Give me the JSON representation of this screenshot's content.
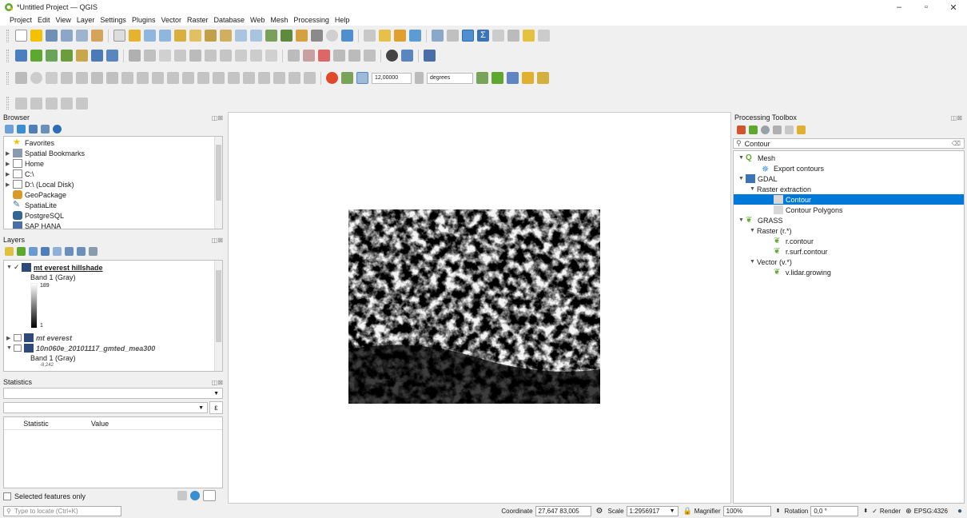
{
  "window": {
    "title": "*Untitled Project — QGIS",
    "minimize": "–",
    "maximize": "▫",
    "close": "✕"
  },
  "menu": [
    "Project",
    "Edit",
    "View",
    "Layer",
    "Settings",
    "Plugins",
    "Vector",
    "Raster",
    "Database",
    "Web",
    "Mesh",
    "Processing",
    "Help"
  ],
  "toolbar": {
    "angle_value": "12,00000",
    "angle_unit": "degrees"
  },
  "browser": {
    "title": "Browser",
    "items": [
      {
        "label": "Favorites",
        "icon": "star-icon"
      },
      {
        "label": "Spatial Bookmarks",
        "icon": "bookmark-icon"
      },
      {
        "label": "Home",
        "icon": "home-folder-icon"
      },
      {
        "label": "C:\\",
        "icon": "drive-icon"
      },
      {
        "label": "D:\\ (Local Disk)",
        "icon": "drive-icon"
      },
      {
        "label": "GeoPackage",
        "icon": "geopackage-icon"
      },
      {
        "label": "SpatiaLite",
        "icon": "spatialite-icon"
      },
      {
        "label": "PostgreSQL",
        "icon": "postgresql-icon"
      },
      {
        "label": "SAP HANA",
        "icon": "hana-icon"
      }
    ]
  },
  "layers": {
    "title": "Layers",
    "items": [
      {
        "name": "mt everest hillshade",
        "checked": "✓",
        "band": "Band 1 (Gray)",
        "max": "189",
        "min": "1"
      },
      {
        "name": "mt everest",
        "checked": ""
      },
      {
        "name": "10n060e_20101117_gmted_mea300",
        "checked": "",
        "band": "Band 1 (Gray)",
        "min": "-8,242"
      }
    ]
  },
  "statistics": {
    "title": "Statistics",
    "columns": [
      "Statistic",
      "Value"
    ],
    "selected_only": "Selected features only",
    "epsilon": "ε"
  },
  "processing": {
    "title": "Processing Toolbox",
    "search_value": "Contour",
    "tree": [
      {
        "label": "Mesh",
        "level": 0,
        "icon": "qgis-icon"
      },
      {
        "label": "Export contours",
        "level": 2,
        "icon": "gear-icon"
      },
      {
        "label": "GDAL",
        "level": 0,
        "icon": "gdal-icon"
      },
      {
        "label": "Raster extraction",
        "level": 1,
        "icon": ""
      },
      {
        "label": "Contour",
        "level": 2,
        "icon": "contour-icon",
        "selected": true
      },
      {
        "label": "Contour Polygons",
        "level": 2,
        "icon": "contour-icon"
      },
      {
        "label": "GRASS",
        "level": 0,
        "icon": "grass-icon"
      },
      {
        "label": "Raster (r.*)",
        "level": 1,
        "icon": ""
      },
      {
        "label": "r.contour",
        "level": 2,
        "icon": "grass-icon"
      },
      {
        "label": "r.surf.contour",
        "level": 2,
        "icon": "grass-icon"
      },
      {
        "label": "Vector (v.*)",
        "level": 1,
        "icon": ""
      },
      {
        "label": "v.lidar.growing",
        "level": 2,
        "icon": "grass-icon"
      }
    ]
  },
  "status": {
    "locator_placeholder": "Type to locate (Ctrl+K)",
    "coordinate_label": "Coordinate",
    "coordinate_value": "27,647 83,005",
    "scale_label": "Scale",
    "scale_value": "1:2956917",
    "magnifier_label": "Magnifier",
    "magnifier_value": "100%",
    "rotation_label": "Rotation",
    "rotation_value": "0,0 °",
    "render_label": "Render",
    "crs": "EPSG:4326"
  },
  "colors": {
    "accent": "#0078d7",
    "qgis_green": "#5fa82f",
    "toolbar_yellow": "#f2c200"
  }
}
